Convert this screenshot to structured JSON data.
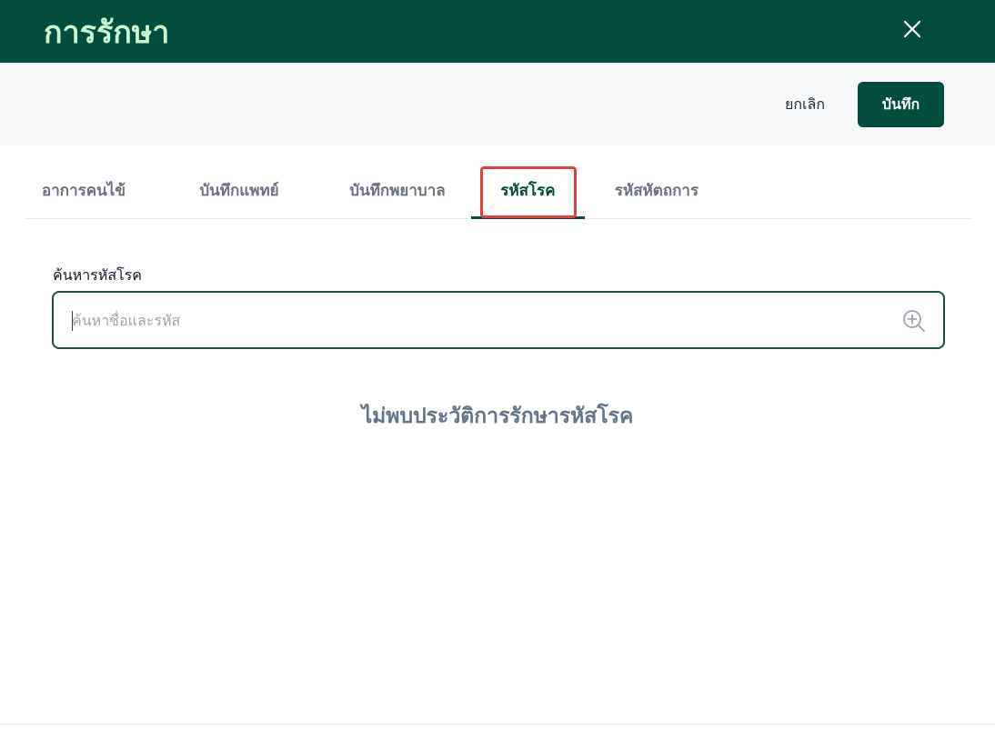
{
  "header": {
    "title": "การรักษา",
    "close_icon": "close-icon",
    "background": "#034d3e",
    "title_color": "#c8f5d2"
  },
  "toolbar": {
    "cancel_label": "ยกเลิก",
    "save_label": "บันทึก"
  },
  "tabs": [
    {
      "label": "อาการคนไข้",
      "active": false
    },
    {
      "label": "บันทึกแพทย์",
      "active": false
    },
    {
      "label": "บันทึกพยาบาล",
      "active": false
    },
    {
      "label": "รหัสโรค",
      "active": true
    },
    {
      "label": "รหัสหัตถการ",
      "active": false
    }
  ],
  "search": {
    "label": "ค้นหารหัสโรค",
    "value": "",
    "placeholder": "ค้นหาชื่อและรหัส",
    "icon": "zoom-in-icon"
  },
  "empty_state": "ไม่พบประวัติการรักษารหัสโรค",
  "colors": {
    "accent": "#034d3e",
    "highlight": "#e53e3e"
  }
}
